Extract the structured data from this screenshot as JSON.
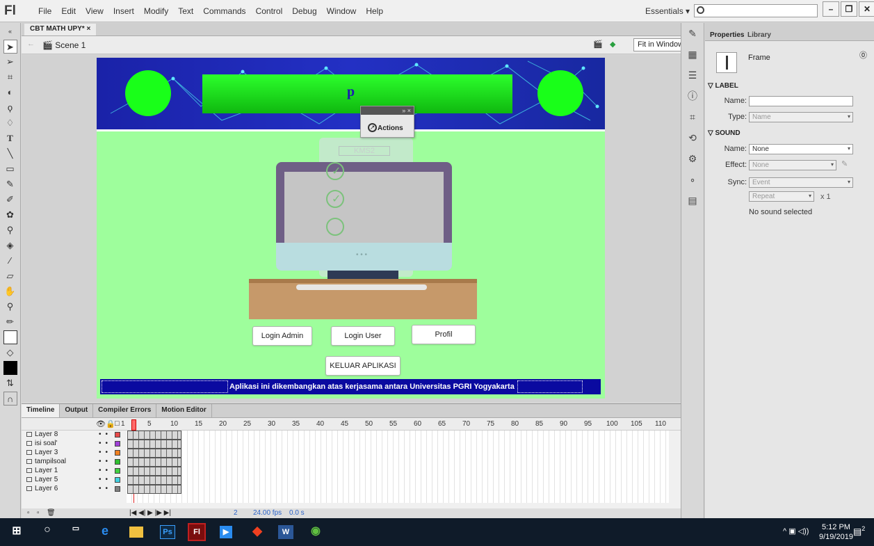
{
  "app": {
    "logo": "Fl",
    "workspace": "Essentials"
  },
  "menu": [
    "File",
    "Edit",
    "View",
    "Insert",
    "Modify",
    "Text",
    "Commands",
    "Control",
    "Debug",
    "Window",
    "Help"
  ],
  "document": {
    "tab_title": "CBT MATH UPY*",
    "scene": "Scene 1",
    "zoom": "Fit in Window"
  },
  "stage": {
    "banner_text": "p",
    "paper_label": "KMS2",
    "actions_panel": "Actions",
    "buttons": {
      "login_admin": "Login Admin",
      "login_user": "Login User",
      "profil": "Profil",
      "keluar": "KELUAR APLIKASI"
    },
    "footer_text": "Aplikasi ini dikembangkan atas kerjasama antara Universitas PGRI Yogyakarta",
    "colors": {
      "stage_bg": "#9efe9c",
      "banner": "#2330c4",
      "footer": "#0a0aa0",
      "circle": "#19ff19"
    }
  },
  "properties": {
    "tabs": [
      "Properties",
      "Library"
    ],
    "frame_label": "Frame",
    "label_section": "LABEL",
    "name_label": "Name:",
    "type_label": "Type:",
    "type_value": "Name",
    "sound_section": "SOUND",
    "sound_name_value": "None",
    "effect_label": "Effect:",
    "effect_value": "None",
    "sync_label": "Sync:",
    "sync_value": "Event",
    "repeat_value": "Repeat",
    "repeat_times": "x 1",
    "no_sound": "No sound selected"
  },
  "timeline": {
    "tabs": [
      "Timeline",
      "Output",
      "Compiler Errors",
      "Motion Editor"
    ],
    "frame_numbers": [
      "1",
      "5",
      "10",
      "15",
      "20",
      "25",
      "30",
      "35",
      "40",
      "45",
      "50",
      "55",
      "60",
      "65",
      "70",
      "75",
      "80",
      "85",
      "90",
      "95",
      "100",
      "105",
      "110"
    ],
    "layers": [
      {
        "name": "Layer 8",
        "color": "#e84a4a"
      },
      {
        "name": "isi soal'",
        "color": "#a040d8"
      },
      {
        "name": "Layer 3",
        "color": "#f08020"
      },
      {
        "name": "tampilsoal",
        "color": "#30c030"
      },
      {
        "name": "Layer 1",
        "color": "#40d040"
      },
      {
        "name": "Layer 5",
        "color": "#40d0e0"
      },
      {
        "name": "Layer 6",
        "color": "#808080"
      }
    ],
    "footer": {
      "current_frame": "2",
      "fps": "24.00 fps",
      "time": "0.0 s"
    }
  },
  "taskbar": {
    "time": "5:12 PM",
    "date": "9/19/2019",
    "notification_count": "2"
  }
}
